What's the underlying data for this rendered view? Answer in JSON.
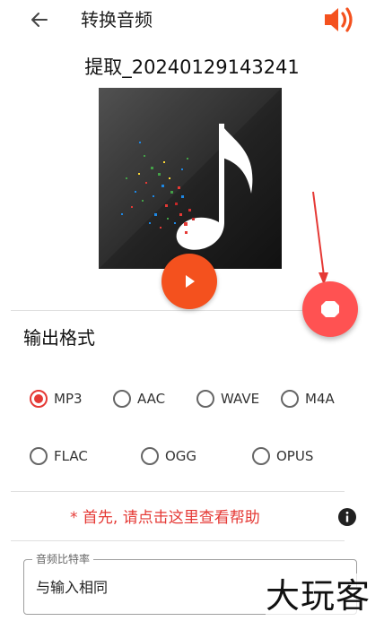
{
  "header": {
    "title": "转换音频",
    "back_icon": "arrow-left-icon",
    "speaker_icon": "volume-icon",
    "accent_color": "#f4511e"
  },
  "file": {
    "name": "提取_20240129143241"
  },
  "player": {
    "play_icon": "play-icon",
    "stop_icon": "stop-icon",
    "play_color": "#f4511e",
    "stop_color": "#ff5252"
  },
  "output_format": {
    "title": "输出格式",
    "options": [
      {
        "label": "MP3",
        "checked": true
      },
      {
        "label": "AAC",
        "checked": false
      },
      {
        "label": "WAVE",
        "checked": false
      },
      {
        "label": "M4A",
        "checked": false
      },
      {
        "label": "FLAC",
        "checked": false
      },
      {
        "label": "OGG",
        "checked": false
      },
      {
        "label": "OPUS",
        "checked": false
      }
    ]
  },
  "help": {
    "text": "* 首先, 请点击这里查看帮助",
    "icon": "info-icon",
    "color": "#e53935"
  },
  "bitrate": {
    "label": "音频比特率",
    "value": "与输入相同"
  },
  "watermark": {
    "text": "大玩客"
  }
}
